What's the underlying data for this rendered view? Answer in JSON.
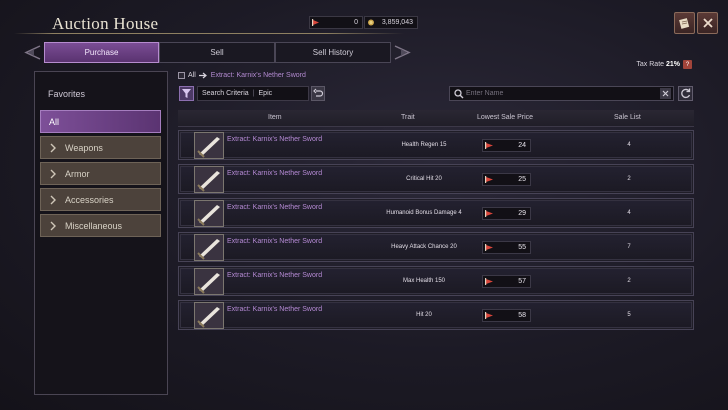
{
  "header": {
    "title": "Auction House",
    "currency_a": "0",
    "currency_b": "3,859,043"
  },
  "tabs": [
    {
      "label": "Purchase"
    },
    {
      "label": "Sell"
    },
    {
      "label": "Sell History"
    }
  ],
  "tax": {
    "label": "Tax Rate",
    "value": "21%",
    "help": "?"
  },
  "sidebar": {
    "favorites": "Favorites",
    "all": "All",
    "categories": [
      {
        "label": "Weapons"
      },
      {
        "label": "Armor"
      },
      {
        "label": "Accessories"
      },
      {
        "label": "Miscellaneous"
      }
    ]
  },
  "breadcrumb": {
    "root": "All",
    "current": "Extract: Karnix's Nether Sword"
  },
  "filter": {
    "criteria_label": "Search Criteria",
    "criteria_value": "Epic"
  },
  "search": {
    "placeholder": "Enter Name",
    "value": ""
  },
  "table": {
    "columns": [
      "Item",
      "Trait",
      "Lowest Sale Price",
      "Sale List"
    ],
    "rows": [
      {
        "name": "Extract: Karnix's Nether Sword",
        "trait": "Health Regen 15",
        "price": "24",
        "count": "4"
      },
      {
        "name": "Extract: Karnix's Nether Sword",
        "trait": "Critical Hit 20",
        "price": "25",
        "count": "2"
      },
      {
        "name": "Extract: Karnix's Nether Sword",
        "trait": "Humanoid Bonus Damage 4",
        "price": "29",
        "count": "4"
      },
      {
        "name": "Extract: Karnix's Nether Sword",
        "trait": "Heavy Attack Chance 20",
        "price": "55",
        "count": "7"
      },
      {
        "name": "Extract: Karnix's Nether Sword",
        "trait": "Max Health 150",
        "price": "57",
        "count": "2"
      },
      {
        "name": "Extract: Karnix's Nether Sword",
        "trait": "Hit 20",
        "price": "58",
        "count": "5"
      }
    ]
  },
  "colors": {
    "accent_purple": "#7a4d95",
    "item_name": "#b58ad4",
    "currency_red": "#d9463b"
  },
  "icons": [
    "diamond-currency-icon",
    "gold-coin-icon",
    "scroll-icon",
    "close-icon",
    "filter-icon",
    "undo-icon",
    "search-icon",
    "refresh-icon",
    "chevron-right-icon",
    "sword-icon"
  ]
}
